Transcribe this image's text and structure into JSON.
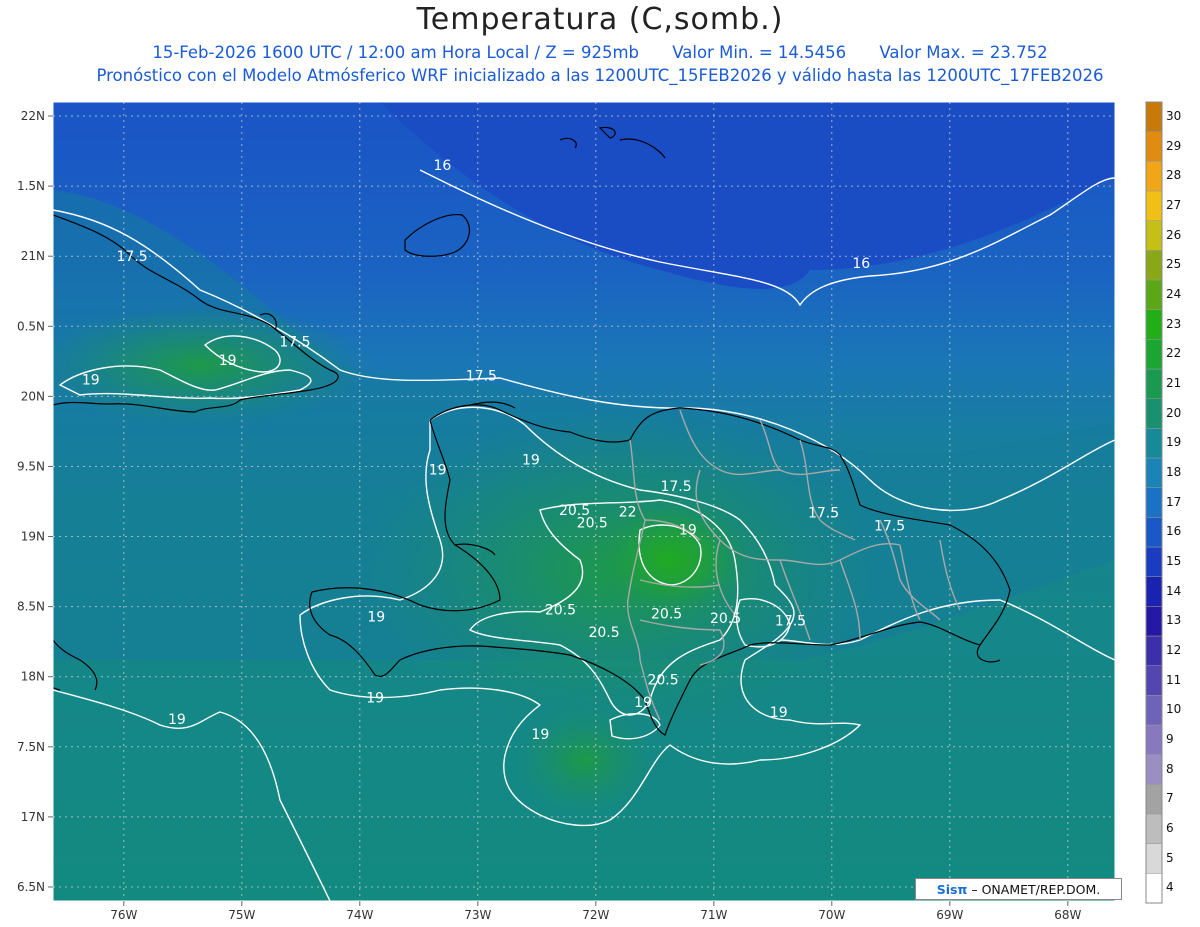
{
  "title": "Temperatura (C,somb.)",
  "subtitle": {
    "datetime": "15-Feb-2026  1600 UTC / 12:00 am Hora Local / Z = 925mb",
    "min": "Valor Min. = 14.5456",
    "max": "Valor Max. = 23.752",
    "model": "Pronóstico con el Modelo Atmósferico WRF inicializado a las 1200UTC_15FEB2026 y válido hasta las  1200UTC_17FEB2026"
  },
  "logo": {
    "brand": "Sisπ",
    "text": "– ONAMET/REP.DOM."
  },
  "chart_data": {
    "type": "heatmap",
    "xlim": [
      -76.6,
      -67.6
    ],
    "ylim": [
      16.4,
      22.1
    ],
    "lon_ticks": [
      "76W",
      "75W",
      "74W",
      "73W",
      "72W",
      "71W",
      "70W",
      "69W",
      "68W"
    ],
    "lat_ticks": [
      "22N",
      "1.5N",
      "21N",
      "0.5N",
      "20N",
      "9.5N",
      "19N",
      "8.5N",
      "18N",
      "7.5N",
      "17N",
      "6.5N"
    ],
    "colorbar": {
      "levels": [
        4,
        5,
        6,
        7,
        8,
        9,
        10,
        11,
        12,
        13,
        14,
        15,
        16,
        17,
        18,
        19,
        20,
        21,
        22,
        23,
        24,
        25,
        26,
        27,
        28,
        29,
        30
      ],
      "colors": [
        "#ffffff",
        "#d9d9d9",
        "#bdbdbd",
        "#a3a3a3",
        "#9a8ec2",
        "#8878c0",
        "#6f63b8",
        "#5446b0",
        "#3c30aa",
        "#2418a4",
        "#1a22b0",
        "#1a3cc0",
        "#1a58c8",
        "#1a72c4",
        "#1a84b8",
        "#168a98",
        "#1a9070",
        "#1a9a50",
        "#1aa630",
        "#22ae16",
        "#5aa816",
        "#8aa816",
        "#c4c016",
        "#f0c016",
        "#f0a616",
        "#e08c10",
        "#c87a08"
      ]
    },
    "contour_labels": [
      {
        "text": "16",
        "lon": -73.3,
        "lat": 21.65
      },
      {
        "text": "16",
        "lon": -69.75,
        "lat": 20.95
      },
      {
        "text": "17.5",
        "lon": -75.93,
        "lat": 21.0
      },
      {
        "text": "17.5",
        "lon": -74.55,
        "lat": 20.39
      },
      {
        "text": "17.5",
        "lon": -72.97,
        "lat": 20.15
      },
      {
        "text": "17.5",
        "lon": -71.32,
        "lat": 19.36
      },
      {
        "text": "17.5",
        "lon": -70.07,
        "lat": 19.17
      },
      {
        "text": "17.5",
        "lon": -69.51,
        "lat": 19.08
      },
      {
        "text": "17.5",
        "lon": -70.35,
        "lat": 18.4
      },
      {
        "text": "19",
        "lon": -76.28,
        "lat": 20.12
      },
      {
        "text": "19",
        "lon": -75.12,
        "lat": 20.26
      },
      {
        "text": "19",
        "lon": -73.34,
        "lat": 19.48
      },
      {
        "text": "19",
        "lon": -72.55,
        "lat": 19.55
      },
      {
        "text": "19",
        "lon": -71.22,
        "lat": 19.05
      },
      {
        "text": "19",
        "lon": -73.86,
        "lat": 18.43
      },
      {
        "text": "19",
        "lon": -73.87,
        "lat": 17.85
      },
      {
        "text": "19",
        "lon": -75.55,
        "lat": 17.7
      },
      {
        "text": "19",
        "lon": -72.47,
        "lat": 17.59
      },
      {
        "text": "19",
        "lon": -70.45,
        "lat": 17.75
      },
      {
        "text": "19",
        "lon": -71.6,
        "lat": 17.82
      },
      {
        "text": "20.5",
        "lon": -72.18,
        "lat": 19.19
      },
      {
        "text": "20.5",
        "lon": -72.03,
        "lat": 19.1
      },
      {
        "text": "20.5",
        "lon": -72.3,
        "lat": 18.48
      },
      {
        "text": "20.5",
        "lon": -71.93,
        "lat": 18.32
      },
      {
        "text": "20.5",
        "lon": -71.4,
        "lat": 18.45
      },
      {
        "text": "20.5",
        "lon": -70.9,
        "lat": 18.42
      },
      {
        "text": "20.5",
        "lon": -71.43,
        "lat": 17.98
      },
      {
        "text": "22",
        "lon": -71.73,
        "lat": 19.18
      }
    ]
  }
}
